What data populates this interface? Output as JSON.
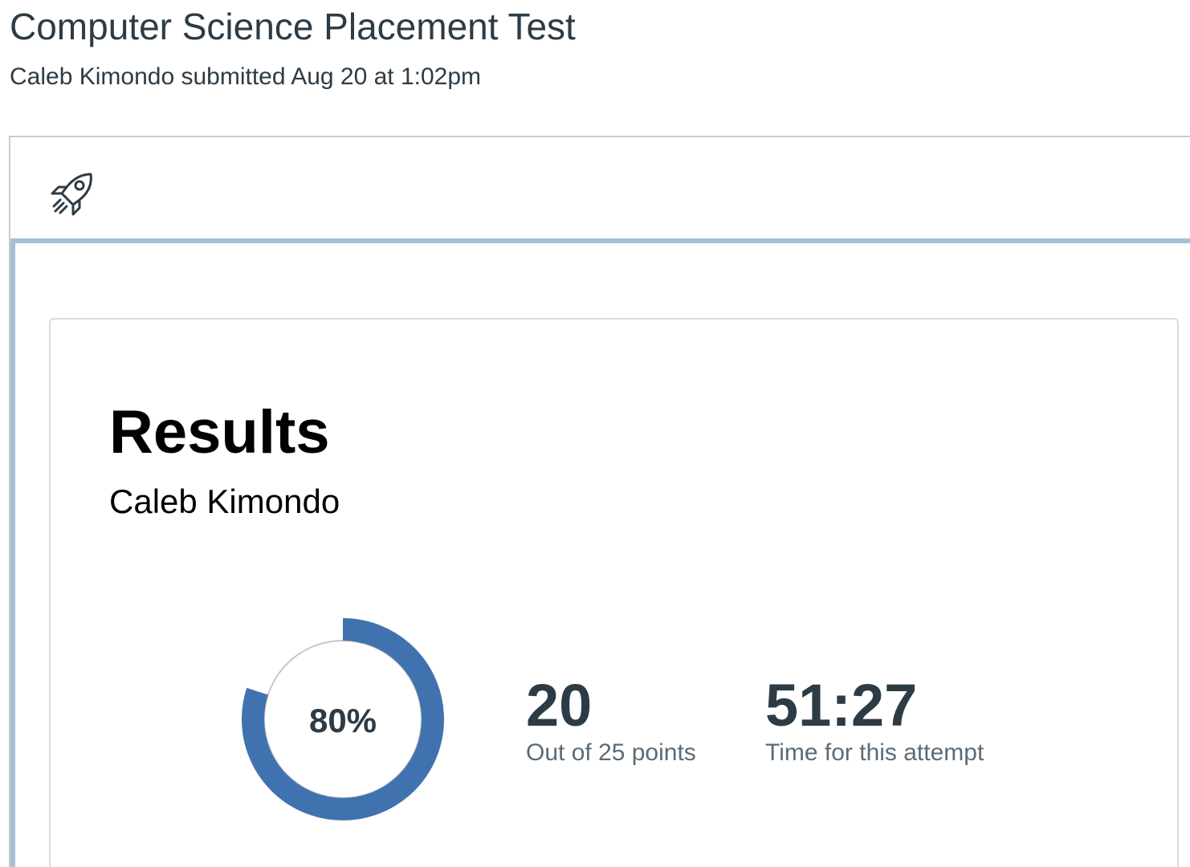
{
  "header": {
    "title": "Computer Science Placement Test",
    "submitted": "Caleb Kimondo submitted Aug 20 at 1:02pm"
  },
  "toolbar": {
    "icon": "rocket-icon"
  },
  "results": {
    "heading": "Results",
    "student_name": "Caleb Kimondo",
    "score_percent_label": "80%",
    "score_fraction": 0.8,
    "score_points": "20",
    "score_caption": "Out of 25 points",
    "time": "51:27",
    "time_caption": "Time for this attempt"
  },
  "colors": {
    "accent": "#4172b0",
    "track": "#c7c7c7",
    "frame_accent": "#a7bfd8",
    "text": "#2d3b45",
    "muted": "#5b6b77"
  }
}
